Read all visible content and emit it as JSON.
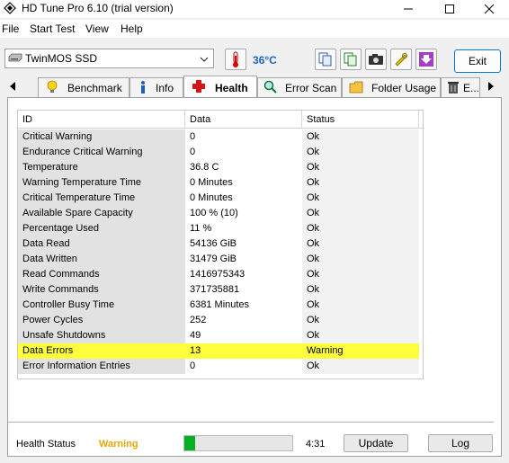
{
  "window": {
    "title": "HD Tune Pro 6.10 (trial version)"
  },
  "menu": [
    "File",
    "Start Test",
    "View",
    "Help"
  ],
  "toolbar": {
    "drive": "TwinMOS SSD",
    "temperature": "36°C",
    "exit_label": "Exit"
  },
  "tabs": [
    {
      "label": "Benchmark",
      "icon": "lightbulb-icon"
    },
    {
      "label": "Info",
      "icon": "info-icon"
    },
    {
      "label": "Health",
      "icon": "health-cross-icon"
    },
    {
      "label": "Error Scan",
      "icon": "magnifier-icon"
    },
    {
      "label": "Folder Usage",
      "icon": "folder-icon"
    },
    {
      "label": "E...",
      "icon": "trash-icon"
    }
  ],
  "table": {
    "headers": {
      "id": "ID",
      "data": "Data",
      "status": "Status"
    },
    "rows": [
      {
        "id": "Critical Warning",
        "data": "0",
        "status": "Ok"
      },
      {
        "id": "Endurance Critical Warning",
        "data": "0",
        "status": "Ok"
      },
      {
        "id": "Temperature",
        "data": "36.8 C",
        "status": "Ok"
      },
      {
        "id": "Warning Temperature Time",
        "data": "0 Minutes",
        "status": "Ok"
      },
      {
        "id": "Critical Temperature Time",
        "data": "0 Minutes",
        "status": "Ok"
      },
      {
        "id": "Available Spare Capacity",
        "data": "100 % (10)",
        "status": "Ok"
      },
      {
        "id": "Percentage Used",
        "data": "11 %",
        "status": "Ok"
      },
      {
        "id": "Data Read",
        "data": "54136 GiB",
        "status": "Ok"
      },
      {
        "id": "Data Written",
        "data": "31479 GiB",
        "status": "Ok"
      },
      {
        "id": "Read Commands",
        "data": "1416975343",
        "status": "Ok"
      },
      {
        "id": "Write Commands",
        "data": "371735881",
        "status": "Ok"
      },
      {
        "id": "Controller Busy Time",
        "data": "6381 Minutes",
        "status": "Ok"
      },
      {
        "id": "Power Cycles",
        "data": "252",
        "status": "Ok"
      },
      {
        "id": "Unsafe Shutdowns",
        "data": "49",
        "status": "Ok"
      },
      {
        "id": "Data Errors",
        "data": "13",
        "status": "Warning"
      },
      {
        "id": "Error Information Entries",
        "data": "0",
        "status": "Ok"
      }
    ]
  },
  "footer": {
    "health_status_label": "Health Status",
    "health_status_value": "Warning",
    "progress_fraction": 0.1,
    "time": "4:31",
    "update_label": "Update",
    "log_label": "Log"
  },
  "colors": {
    "warning_row": "#ffff3c",
    "status_warning_text": "#e5a800",
    "progress_fill": "#06b025",
    "temperature_text": "#1b63c7"
  }
}
